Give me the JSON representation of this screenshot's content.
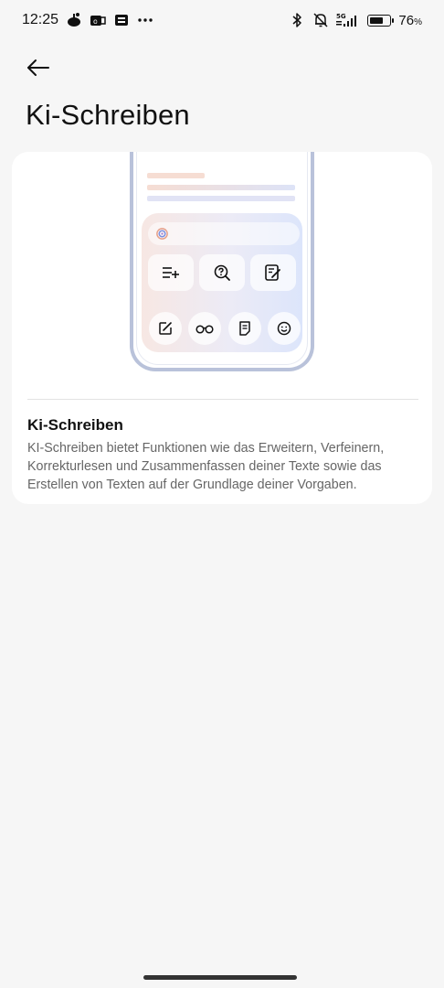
{
  "status_bar": {
    "time": "12:25",
    "battery_percent": "76",
    "battery_percent_sign": "%",
    "battery_level": 0.76,
    "network": "5G",
    "notification_icons": [
      "app-icon",
      "mail-icon",
      "sim-card-icon",
      "more-dots-icon"
    ],
    "system_icons": [
      "bluetooth-icon",
      "muted-bell-icon",
      "signal-icon",
      "battery-icon"
    ]
  },
  "header": {
    "title": "Ki-Schreiben",
    "back_icon": "arrow-left-icon"
  },
  "feature_card": {
    "title": "Ki-Schreiben",
    "description": "KI-Schreiben bietet Funktionen wie das Erweitern, Verfeinern, Korrekturlesen und Zusammenfassen deiner Texte sowie das Erstellen von Texten auf der Grundlage deiner Vorgaben.",
    "illustration": {
      "tool_icons": [
        "list-add-icon",
        "search-question-icon",
        "edit-note-icon"
      ],
      "circle_icons": [
        "compose-icon",
        "glasses-icon",
        "document-icon",
        "smile-icon"
      ]
    }
  },
  "colors": {
    "background": "#f6f6f6",
    "card": "#ffffff",
    "phone_frame": "#b9c2da",
    "panel_left": "#f7e7e3",
    "panel_right": "#dce5fb",
    "line_peach": "#f6ddd3",
    "line_lavender": "#e1e3f5"
  }
}
